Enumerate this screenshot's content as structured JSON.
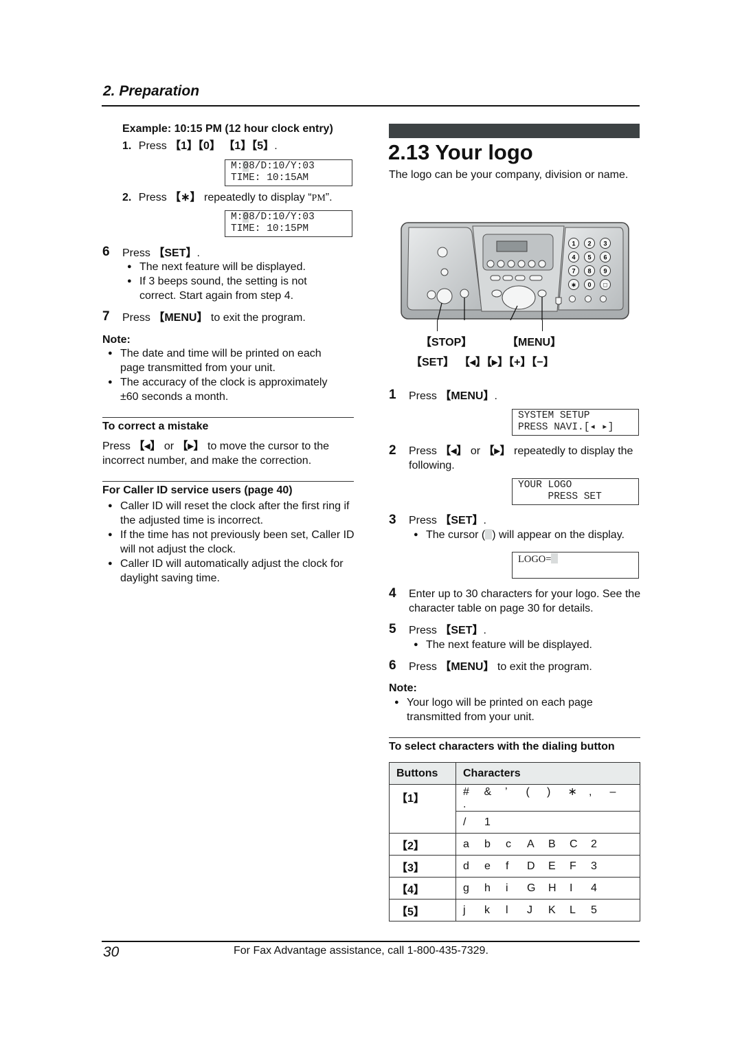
{
  "header": {
    "section_title": "2. Preparation"
  },
  "left": {
    "example_heading": "Example: 10:15 PM (12 hour clock entry)",
    "sub1": {
      "num": "1.",
      "text_pre": "Press ",
      "keys": "【1】【0】 【1】【5】",
      "text_post": "."
    },
    "lcd1": {
      "line1_pre": "M:",
      "line1_hl": "0",
      "line1_post": "8/D:10/Y:03",
      "line2": "TIME: 10:15AM"
    },
    "sub2": {
      "num": "2.",
      "text_pre": "Press ",
      "key": "【∗】",
      "text_mid": " repeatedly to display “",
      "mono": "PM",
      "text_post": "”."
    },
    "lcd2": {
      "line1_pre": "M:",
      "line1_hl": "0",
      "line1_post": "8/D:10/Y:03",
      "line2": "TIME: 10:15PM"
    },
    "step6": {
      "num": "6",
      "text_pre": "Press ",
      "key": "【SET】",
      "text_post": ".",
      "bullets": [
        "The next feature will be displayed.",
        "If 3 beeps sound, the setting is not correct. Start again from step 4."
      ]
    },
    "step7": {
      "num": "7",
      "text_pre": "Press ",
      "key": "【MENU】",
      "text_post": " to exit the program."
    },
    "note_label": "Note:",
    "notes": [
      "The date and time will be printed on each page transmitted from your unit.",
      "The accuracy of the clock is approximately ±60 seconds a month."
    ],
    "correct": {
      "heading": "To correct a mistake",
      "text_pre": "Press ",
      "key_left": "【◂】",
      "text_or": " or ",
      "key_right": "【▸】",
      "text_post": " to move the cursor to the incorrect number, and make the correction."
    },
    "caller_id": {
      "heading": "For Caller ID service users (page 40)",
      "bullets": [
        "Caller ID will reset the clock after the first ring if the adjusted time is incorrect.",
        "If the time has not previously been set, Caller ID will not adjust the clock.",
        "Caller ID will automatically adjust the clock for daylight saving time."
      ]
    }
  },
  "right": {
    "chapter_title": "2.13 Your logo",
    "intro": "The logo can be your company, division or name.",
    "diagram": {
      "callout_stop": "【STOP】",
      "callout_menu": "【MENU】",
      "callout_set": "【SET】",
      "callout_nav": "【◂】【▸】【+】【−】",
      "keypad": [
        "1",
        "2",
        "3",
        "4",
        "5",
        "6",
        "7",
        "8",
        "9",
        "∗",
        "0",
        "□"
      ]
    },
    "step1": {
      "num": "1",
      "text_pre": "Press ",
      "key": "【MENU】",
      "text_post": "."
    },
    "lcd1": {
      "line1": "SYSTEM SETUP",
      "line2": "PRESS NAVI.[◂ ▸]"
    },
    "step2": {
      "num": "2",
      "text_pre": "Press ",
      "key_left": "【◂】",
      "text_or": " or ",
      "key_right": "【▸】",
      "text_post": " repeatedly to display the following."
    },
    "lcd2": {
      "line1": "YOUR LOGO",
      "line2": "     PRESS SET"
    },
    "step3": {
      "num": "3",
      "text_pre": "Press ",
      "key": "【SET】",
      "text_post": ".",
      "bullet_pre": "The cursor (",
      "bullet_post": ") will appear on the display."
    },
    "lcd3": {
      "line1": "LOGO="
    },
    "step4": {
      "num": "4",
      "text": "Enter up to 30 characters for your logo. See the character table on page 30 for details."
    },
    "step5": {
      "num": "5",
      "text_pre": "Press ",
      "key": "【SET】",
      "text_post": ".",
      "bullet": "The next feature will be displayed."
    },
    "step6": {
      "num": "6",
      "text_pre": "Press ",
      "key": "【MENU】",
      "text_post": " to exit the program."
    },
    "note_label": "Note:",
    "notes": [
      "Your logo will be printed on each page transmitted from your unit."
    ],
    "table_heading": "To select characters with the dialing button",
    "table": {
      "headers": [
        "Buttons",
        "Characters"
      ],
      "rows": [
        {
          "button": "【1】",
          "lines": [
            [
              "#",
              "&",
              "’",
              "(",
              ")",
              "∗",
              ",",
              "–",
              "."
            ],
            [
              "/",
              "1"
            ]
          ]
        },
        {
          "button": "【2】",
          "lines": [
            [
              "a",
              "b",
              "c",
              "A",
              "B",
              "C",
              "2"
            ]
          ]
        },
        {
          "button": "【3】",
          "lines": [
            [
              "d",
              "e",
              "f",
              "D",
              "E",
              "F",
              "3"
            ]
          ]
        },
        {
          "button": "【4】",
          "lines": [
            [
              "g",
              "h",
              "i",
              "G",
              "H",
              "I",
              "4"
            ]
          ]
        },
        {
          "button": "【5】",
          "lines": [
            [
              "j",
              "k",
              "l",
              "J",
              "K",
              "L",
              "5"
            ]
          ]
        }
      ]
    }
  },
  "footer": {
    "page_number": "30",
    "assistance": "For Fax Advantage assistance, call 1-800-435-7329."
  }
}
